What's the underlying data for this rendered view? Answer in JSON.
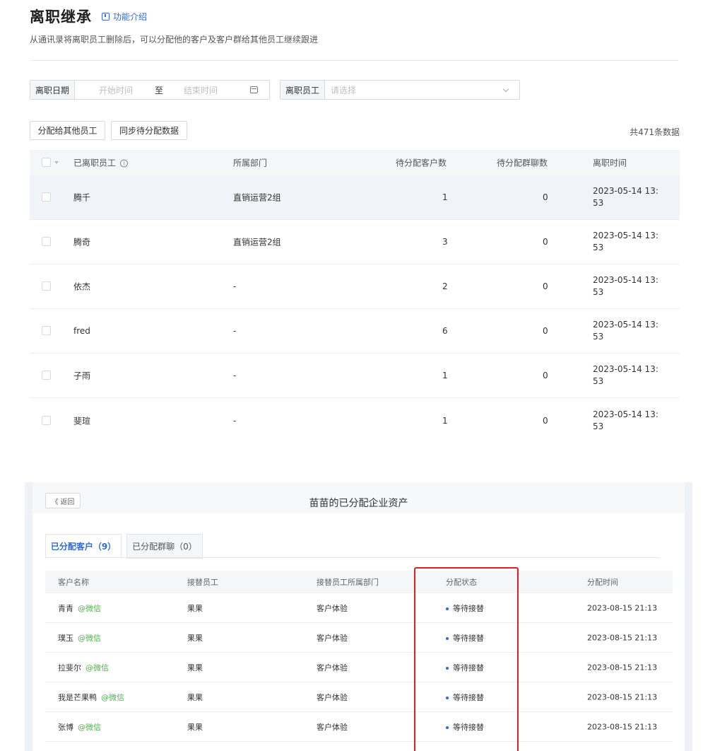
{
  "header": {
    "title": "离职继承",
    "intro_link": "功能介绍",
    "subtitle": "从通讯录将离职员工删除后，可以分配他的客户及客户群给其他员工继续跟进"
  },
  "filters": {
    "date_label": "离职日期",
    "start_placeholder": "开始时间",
    "separator": "至",
    "end_placeholder": "结束时间",
    "employee_label": "离职员工",
    "employee_placeholder": "请选择"
  },
  "actions": {
    "assign_label": "分配给其他员工",
    "sync_label": "同步待分配数据",
    "total_text": "共471条数据"
  },
  "table": {
    "columns": [
      "已离职员工",
      "所属部门",
      "待分配客户数",
      "待分配群聊数",
      "离职时间"
    ],
    "rows": [
      {
        "name": "腾千",
        "dept": "直销运营2组",
        "customers": "1",
        "groups": "0",
        "time": "2023-05-14 13:53"
      },
      {
        "name": "腾奇",
        "dept": "直销运营2组",
        "customers": "3",
        "groups": "0",
        "time": "2023-05-14 13:53"
      },
      {
        "name": "依杰",
        "dept": "-",
        "customers": "2",
        "groups": "0",
        "time": "2023-05-14 13:53"
      },
      {
        "name": "fred",
        "dept": "-",
        "customers": "6",
        "groups": "0",
        "time": "2023-05-14 13:53"
      },
      {
        "name": "子雨",
        "dept": "-",
        "customers": "1",
        "groups": "0",
        "time": "2023-05-14 13:53"
      },
      {
        "name": "斐瑄",
        "dept": "-",
        "customers": "1",
        "groups": "0",
        "time": "2023-05-14 13:53"
      }
    ]
  },
  "panel": {
    "back_label": "《 返回",
    "title": "苗苗的已分配企业资产",
    "tabs": [
      {
        "label": "已分配客户（9）"
      },
      {
        "label": "已分配群聊（0）"
      }
    ],
    "columns": [
      "客户名称",
      "接替员工",
      "接替员工所属部门",
      "分配状态",
      "分配时间"
    ],
    "rows": [
      {
        "name": "青青",
        "tag": "@微信",
        "successor": "果果",
        "dept": "客户体验",
        "status": "等待接替",
        "time": "2023-08-15 21:13"
      },
      {
        "name": "璞玉",
        "tag": "@微信",
        "successor": "果果",
        "dept": "客户体验",
        "status": "等待接替",
        "time": "2023-08-15 21:13"
      },
      {
        "name": "拉斐尔",
        "tag": "@微信",
        "successor": "果果",
        "dept": "客户体验",
        "status": "等待接替",
        "time": "2023-08-15 21:13"
      },
      {
        "name": "我是芒果鸭",
        "tag": "@微信",
        "successor": "果果",
        "dept": "客户体验",
        "status": "等待接替",
        "time": "2023-08-15 21:13"
      },
      {
        "name": "张博",
        "tag": "@微信",
        "successor": "果果",
        "dept": "客户体验",
        "status": "等待接替",
        "time": "2023-08-15 21:13"
      }
    ]
  },
  "colors": {
    "accent": "#2f6bd8",
    "wechat_green": "#52b14f",
    "highlight_red": "#e02020"
  }
}
